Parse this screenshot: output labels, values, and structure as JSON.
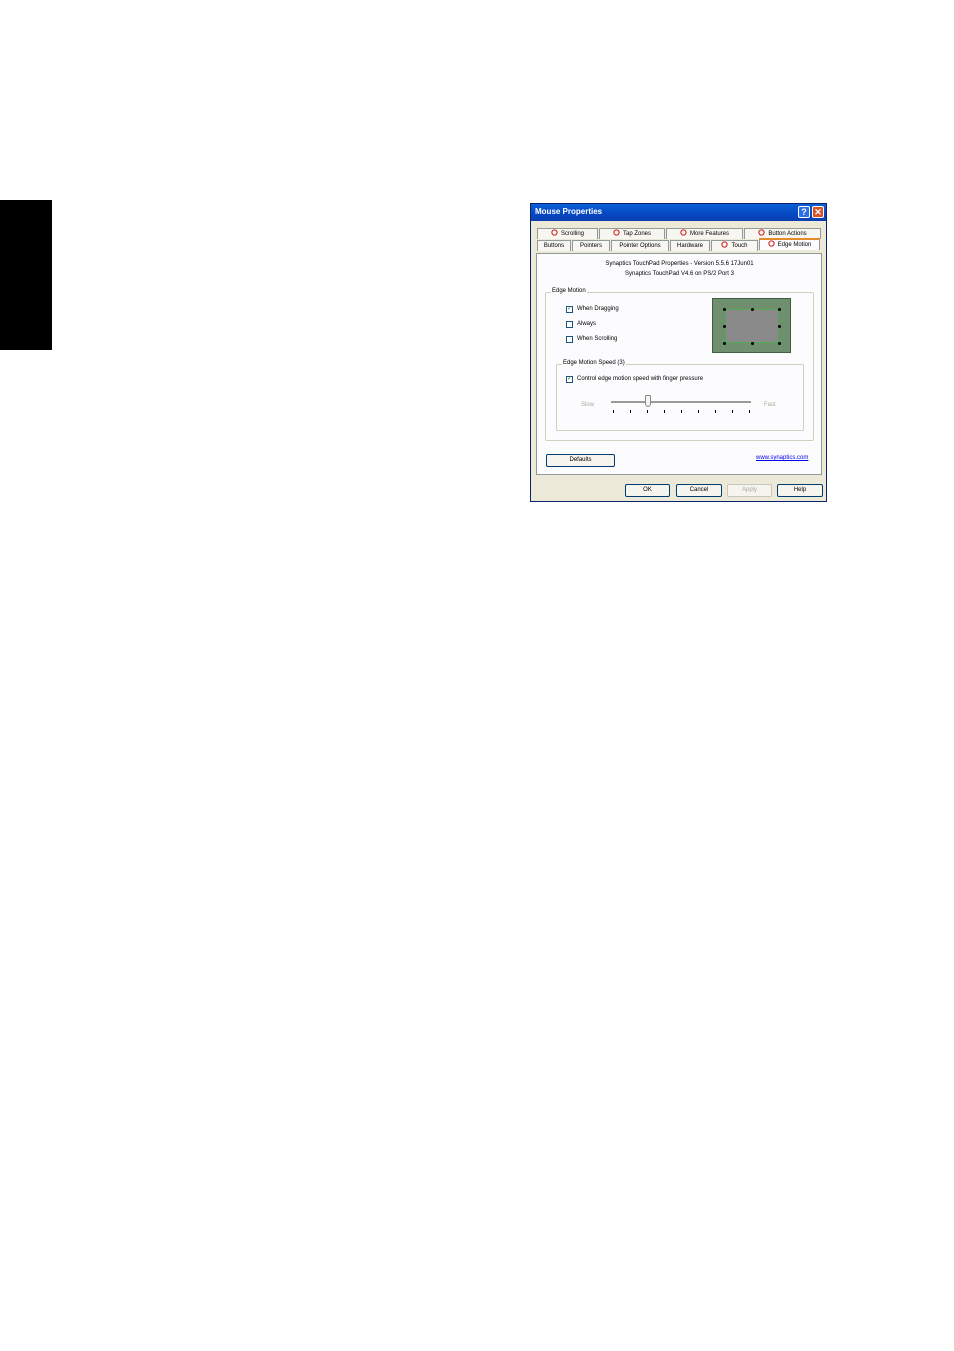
{
  "dialog": {
    "title": "Mouse Properties",
    "help_glyph": "?",
    "close_glyph": "✕",
    "tabs_row_top": [
      "Scrolling",
      "Tap Zones",
      "More Features",
      "Button Actions"
    ],
    "tabs_row_bottom": [
      "Buttons",
      "Pointers",
      "Pointer Options",
      "Hardware",
      "Touch",
      "Edge Motion"
    ],
    "active_tab": "Edge Motion",
    "info_line1": "Synaptics TouchPad Properties - Version 5.5.6 17Jun01",
    "info_line2": "Synaptics TouchPad V4.6 on PS/2 Port 3",
    "edge_motion": {
      "group_label": "Edge Motion",
      "options": [
        {
          "label": "When Dragging",
          "checked": true
        },
        {
          "label": "Always",
          "checked": false
        },
        {
          "label": "When Scrolling",
          "checked": false
        }
      ]
    },
    "edge_speed": {
      "group_label": "Edge Motion Speed (3)",
      "pressure_label": "Control edge motion speed with finger pressure",
      "pressure_checked": true,
      "slow_label": "Slow",
      "fast_label": "Fast",
      "level": 3,
      "tick_count": 9
    },
    "defaults_button": "Defaults",
    "link": "www.synaptics.com",
    "ok_button": "OK",
    "cancel_button": "Cancel",
    "apply_button": "Apply",
    "help_button": "Help",
    "check_glyph": "✓"
  }
}
